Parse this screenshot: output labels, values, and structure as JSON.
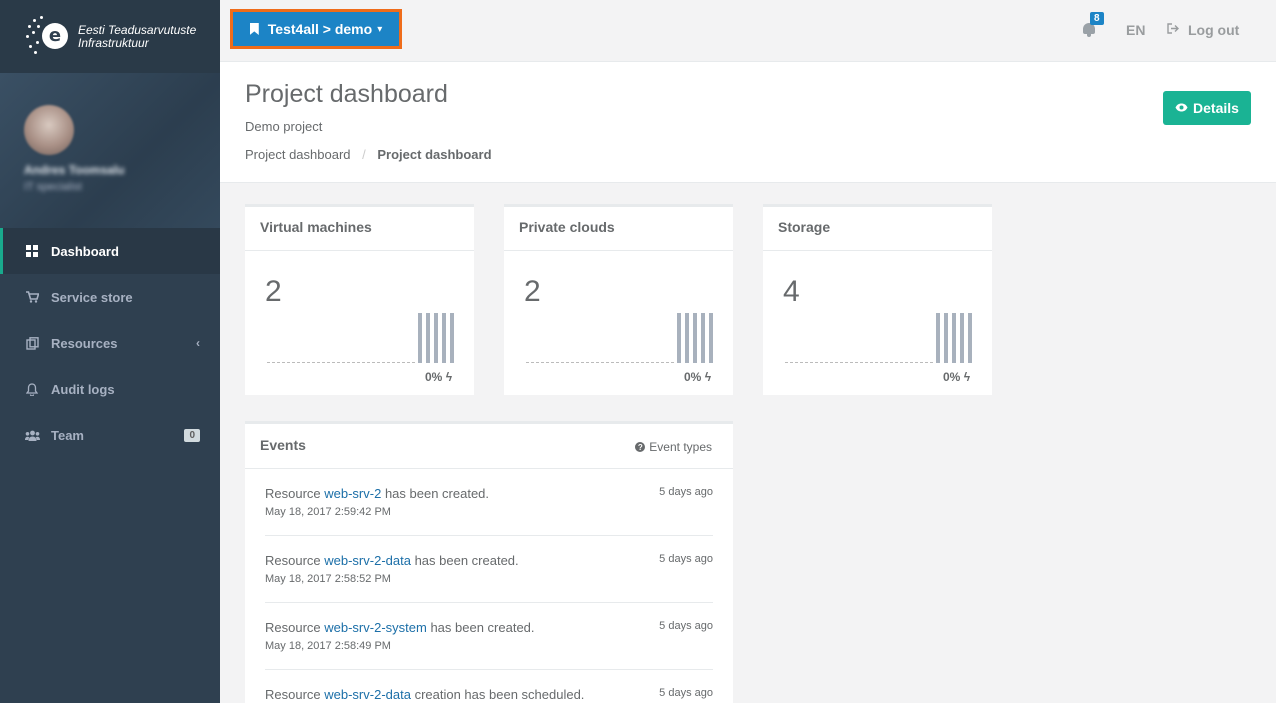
{
  "brand": {
    "line1": "Eesti Teadusarvutuste",
    "line2": "Infrastruktuur",
    "mark": "e"
  },
  "profile": {
    "name": "Andres Toomsalu",
    "role": "IT specialist"
  },
  "sidebar": {
    "items": [
      {
        "label": "Dashboard",
        "icon": "dashboard-icon",
        "active": true
      },
      {
        "label": "Service store",
        "icon": "cart-icon"
      },
      {
        "label": "Resources",
        "icon": "resources-icon"
      },
      {
        "label": "Audit logs",
        "icon": "bell-icon"
      },
      {
        "label": "Team",
        "icon": "users-icon",
        "badge": "0"
      }
    ]
  },
  "topbar": {
    "project_selector": "Test4all > demo",
    "notifications_count": "8",
    "language": "EN",
    "logout": "Log out"
  },
  "header": {
    "title": "Project dashboard",
    "subtitle": "Demo project",
    "breadcrumb": [
      "Project dashboard",
      "Project dashboard"
    ],
    "details_button": "Details"
  },
  "cards": [
    {
      "title": "Virtual machines",
      "value": "2",
      "percent": "0%"
    },
    {
      "title": "Private clouds",
      "value": "2",
      "percent": "0%"
    },
    {
      "title": "Storage",
      "value": "4",
      "percent": "0%"
    }
  ],
  "events": {
    "title": "Events",
    "types_label": "Event types",
    "items": [
      {
        "prefix": "Resource ",
        "link": "web-srv-2",
        "suffix": " has been created.",
        "date": "May 18, 2017 2:59:42 PM",
        "ago": "5 days ago"
      },
      {
        "prefix": "Resource ",
        "link": "web-srv-2-data",
        "suffix": " has been created.",
        "date": "May 18, 2017 2:58:52 PM",
        "ago": "5 days ago"
      },
      {
        "prefix": "Resource ",
        "link": "web-srv-2-system",
        "suffix": " has been created.",
        "date": "May 18, 2017 2:58:49 PM",
        "ago": "5 days ago"
      },
      {
        "prefix": "Resource ",
        "link": "web-srv-2-data",
        "suffix": " creation has been scheduled.",
        "date": "",
        "ago": "5 days ago"
      }
    ]
  },
  "colors": {
    "sidebar": "#2f4050",
    "accent": "#1ab394",
    "primary": "#1c84c6",
    "highlight": "#ef6c1a"
  }
}
